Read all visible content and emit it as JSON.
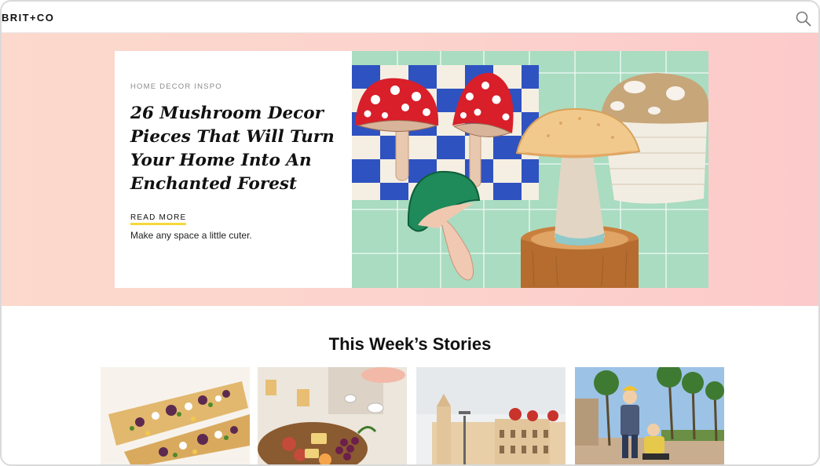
{
  "header": {
    "logo": "BRIT+CO",
    "search_icon": "search-icon"
  },
  "hero": {
    "kicker": "HOME DECOR INSPO",
    "headline": "26 Mushroom Decor Pieces That Will Turn Your Home Into An Enchanted Forest",
    "read_more": "READ MORE",
    "dek": "Make any space a little cuter.",
    "image": "mushroom-decor-collage",
    "colors": {
      "band": "#fcd5cc",
      "underline": "#f7d83a",
      "tile_green": "#a9dcc0"
    }
  },
  "stories": {
    "title": "This Week’s Stories",
    "items": [
      {
        "image": "flatbread-pizza-photo"
      },
      {
        "image": "charcuterie-board-photo"
      },
      {
        "image": "palace-architecture-photo"
      },
      {
        "image": "family-outdoors-photo"
      }
    ]
  }
}
